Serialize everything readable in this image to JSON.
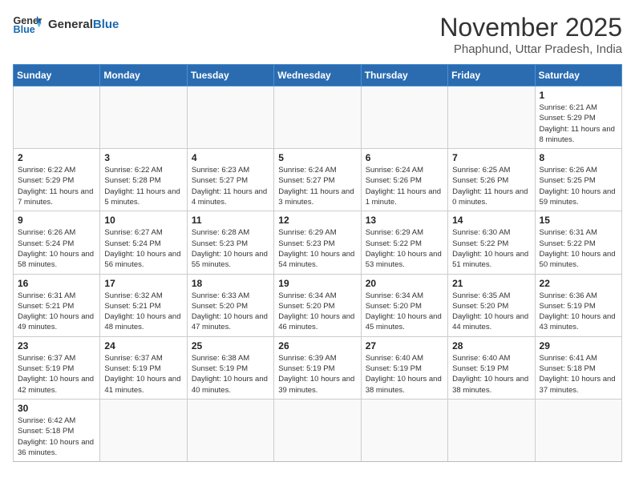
{
  "header": {
    "logo_general": "General",
    "logo_blue": "Blue",
    "month_title": "November 2025",
    "subtitle": "Phaphund, Uttar Pradesh, India"
  },
  "weekdays": [
    "Sunday",
    "Monday",
    "Tuesday",
    "Wednesday",
    "Thursday",
    "Friday",
    "Saturday"
  ],
  "weeks": [
    [
      {
        "day": "",
        "info": ""
      },
      {
        "day": "",
        "info": ""
      },
      {
        "day": "",
        "info": ""
      },
      {
        "day": "",
        "info": ""
      },
      {
        "day": "",
        "info": ""
      },
      {
        "day": "",
        "info": ""
      },
      {
        "day": "1",
        "info": "Sunrise: 6:21 AM\nSunset: 5:29 PM\nDaylight: 11 hours and 8 minutes."
      }
    ],
    [
      {
        "day": "2",
        "info": "Sunrise: 6:22 AM\nSunset: 5:29 PM\nDaylight: 11 hours and 7 minutes."
      },
      {
        "day": "3",
        "info": "Sunrise: 6:22 AM\nSunset: 5:28 PM\nDaylight: 11 hours and 5 minutes."
      },
      {
        "day": "4",
        "info": "Sunrise: 6:23 AM\nSunset: 5:27 PM\nDaylight: 11 hours and 4 minutes."
      },
      {
        "day": "5",
        "info": "Sunrise: 6:24 AM\nSunset: 5:27 PM\nDaylight: 11 hours and 3 minutes."
      },
      {
        "day": "6",
        "info": "Sunrise: 6:24 AM\nSunset: 5:26 PM\nDaylight: 11 hours and 1 minute."
      },
      {
        "day": "7",
        "info": "Sunrise: 6:25 AM\nSunset: 5:26 PM\nDaylight: 11 hours and 0 minutes."
      },
      {
        "day": "8",
        "info": "Sunrise: 6:26 AM\nSunset: 5:25 PM\nDaylight: 10 hours and 59 minutes."
      }
    ],
    [
      {
        "day": "9",
        "info": "Sunrise: 6:26 AM\nSunset: 5:24 PM\nDaylight: 10 hours and 58 minutes."
      },
      {
        "day": "10",
        "info": "Sunrise: 6:27 AM\nSunset: 5:24 PM\nDaylight: 10 hours and 56 minutes."
      },
      {
        "day": "11",
        "info": "Sunrise: 6:28 AM\nSunset: 5:23 PM\nDaylight: 10 hours and 55 minutes."
      },
      {
        "day": "12",
        "info": "Sunrise: 6:29 AM\nSunset: 5:23 PM\nDaylight: 10 hours and 54 minutes."
      },
      {
        "day": "13",
        "info": "Sunrise: 6:29 AM\nSunset: 5:22 PM\nDaylight: 10 hours and 53 minutes."
      },
      {
        "day": "14",
        "info": "Sunrise: 6:30 AM\nSunset: 5:22 PM\nDaylight: 10 hours and 51 minutes."
      },
      {
        "day": "15",
        "info": "Sunrise: 6:31 AM\nSunset: 5:22 PM\nDaylight: 10 hours and 50 minutes."
      }
    ],
    [
      {
        "day": "16",
        "info": "Sunrise: 6:31 AM\nSunset: 5:21 PM\nDaylight: 10 hours and 49 minutes."
      },
      {
        "day": "17",
        "info": "Sunrise: 6:32 AM\nSunset: 5:21 PM\nDaylight: 10 hours and 48 minutes."
      },
      {
        "day": "18",
        "info": "Sunrise: 6:33 AM\nSunset: 5:20 PM\nDaylight: 10 hours and 47 minutes."
      },
      {
        "day": "19",
        "info": "Sunrise: 6:34 AM\nSunset: 5:20 PM\nDaylight: 10 hours and 46 minutes."
      },
      {
        "day": "20",
        "info": "Sunrise: 6:34 AM\nSunset: 5:20 PM\nDaylight: 10 hours and 45 minutes."
      },
      {
        "day": "21",
        "info": "Sunrise: 6:35 AM\nSunset: 5:20 PM\nDaylight: 10 hours and 44 minutes."
      },
      {
        "day": "22",
        "info": "Sunrise: 6:36 AM\nSunset: 5:19 PM\nDaylight: 10 hours and 43 minutes."
      }
    ],
    [
      {
        "day": "23",
        "info": "Sunrise: 6:37 AM\nSunset: 5:19 PM\nDaylight: 10 hours and 42 minutes."
      },
      {
        "day": "24",
        "info": "Sunrise: 6:37 AM\nSunset: 5:19 PM\nDaylight: 10 hours and 41 minutes."
      },
      {
        "day": "25",
        "info": "Sunrise: 6:38 AM\nSunset: 5:19 PM\nDaylight: 10 hours and 40 minutes."
      },
      {
        "day": "26",
        "info": "Sunrise: 6:39 AM\nSunset: 5:19 PM\nDaylight: 10 hours and 39 minutes."
      },
      {
        "day": "27",
        "info": "Sunrise: 6:40 AM\nSunset: 5:19 PM\nDaylight: 10 hours and 38 minutes."
      },
      {
        "day": "28",
        "info": "Sunrise: 6:40 AM\nSunset: 5:19 PM\nDaylight: 10 hours and 38 minutes."
      },
      {
        "day": "29",
        "info": "Sunrise: 6:41 AM\nSunset: 5:18 PM\nDaylight: 10 hours and 37 minutes."
      }
    ],
    [
      {
        "day": "30",
        "info": "Sunrise: 6:42 AM\nSunset: 5:18 PM\nDaylight: 10 hours and 36 minutes."
      },
      {
        "day": "",
        "info": ""
      },
      {
        "day": "",
        "info": ""
      },
      {
        "day": "",
        "info": ""
      },
      {
        "day": "",
        "info": ""
      },
      {
        "day": "",
        "info": ""
      },
      {
        "day": "",
        "info": ""
      }
    ]
  ]
}
